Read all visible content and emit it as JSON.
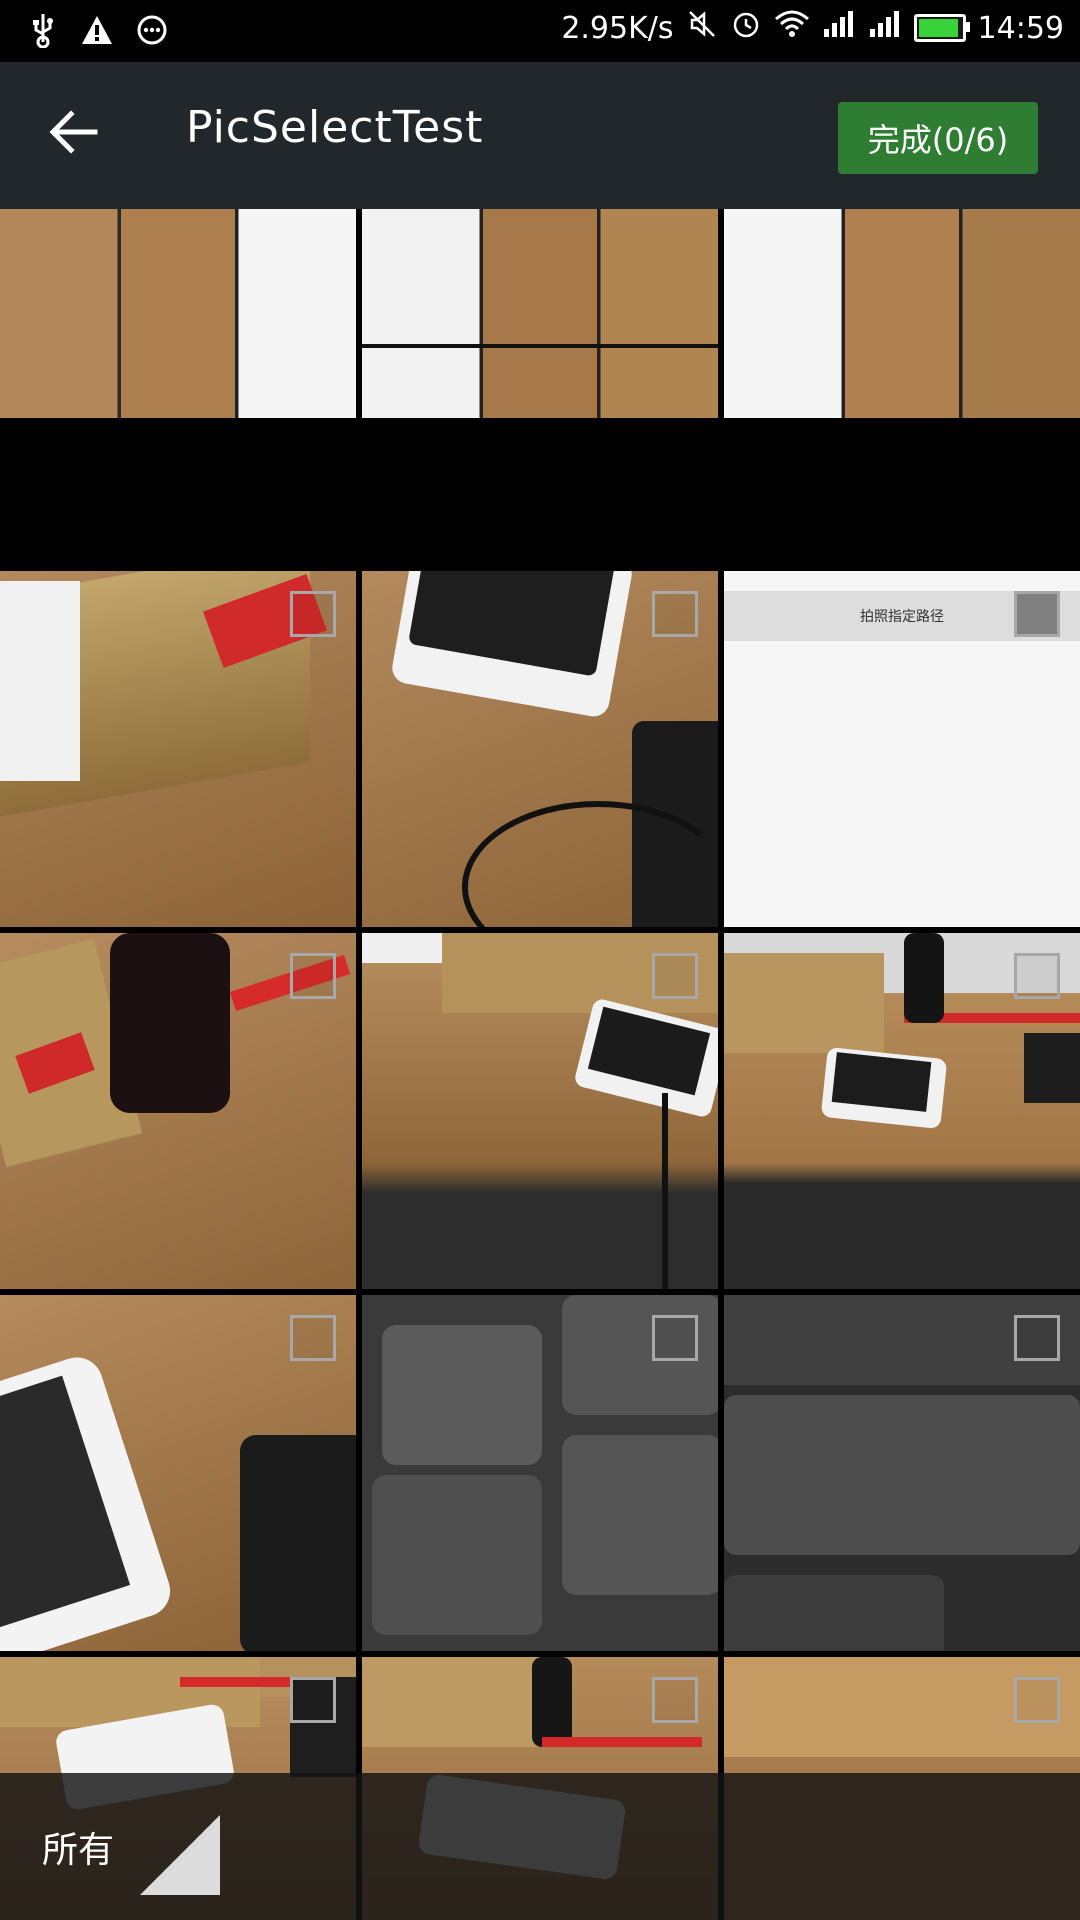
{
  "status_bar": {
    "net_speed": "2.95K/s",
    "time": "14:59",
    "battery_level": 0.95,
    "left_icons": [
      "usb-icon",
      "warning-icon",
      "more-icon"
    ],
    "right_icons": [
      "mute-icon",
      "alarm-icon",
      "wifi-icon",
      "signal-icon",
      "signal-icon",
      "battery-icon"
    ]
  },
  "header": {
    "back_icon": "arrow-left-icon",
    "title": "PicSelectTest",
    "done_label": "完成(0/6)"
  },
  "grid": {
    "columns": 3,
    "items": [
      {
        "desc": "screenshot-of-grid"
      },
      {
        "desc": "screenshot-of-grid"
      },
      {
        "desc": "screenshot-of-grid"
      },
      {
        "desc": "tissue-pack-on-desk"
      },
      {
        "desc": "phone-and-keyboard"
      },
      {
        "desc": "blank-screenshot"
      },
      {
        "desc": "cola-bottle-and-tissue"
      },
      {
        "desc": "phone-charging-on-desk"
      },
      {
        "desc": "desk-with-phone-and-pen"
      },
      {
        "desc": "phone-and-keyboard-close"
      },
      {
        "desc": "keyboard-z-key"
      },
      {
        "desc": "keyboard-caps-lock"
      },
      {
        "desc": "tissue-phone-desk"
      },
      {
        "desc": "phone-bottle-desk"
      },
      {
        "desc": "desk-edge"
      }
    ]
  },
  "blank_screenshot_title": "拍照指定路径",
  "footer": {
    "folder_label": "所有"
  },
  "colors": {
    "header_bg": "#22272b",
    "done_bg": "#2e7d32",
    "desk": "#ad8450"
  }
}
